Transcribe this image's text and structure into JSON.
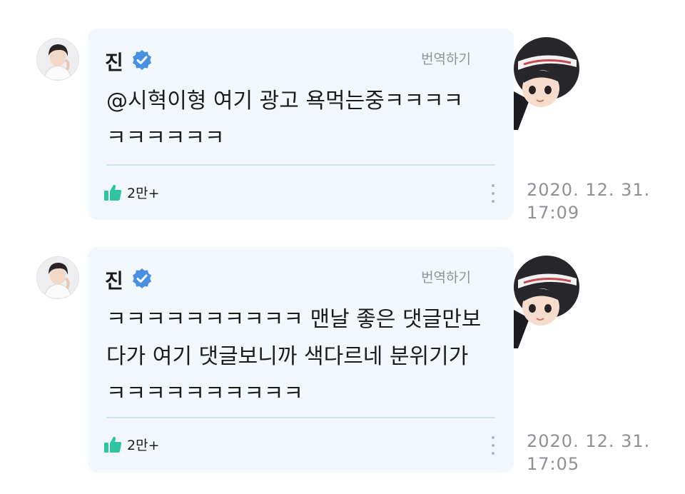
{
  "comments": [
    {
      "author": "진",
      "translate_label": "번역하기",
      "message": "@시혁이형 여기 광고 욕먹는중ㅋㅋㅋㅋ\nㅋㅋㅋㅋㅋㅋ",
      "likes": "2만+",
      "date": "2020. 12. 31.",
      "time": "17:09"
    },
    {
      "author": "진",
      "translate_label": "번역하기",
      "message": "ㅋㅋㅋㅋㅋㅋㅋㅋㅋㅋ 맨날 좋은 댓글만보\n다가 여기 댓글보니까 색다르네 분위기가\nㅋㅋㅋㅋㅋㅋㅋㅋㅋㅋ",
      "likes": "2만+",
      "date": "2020. 12. 31.",
      "time": "17:05"
    }
  ],
  "icons": {
    "verified": "verified-badge-icon",
    "like": "thumbs-up-icon",
    "more": "more-vertical-icon"
  },
  "colors": {
    "bubble_bg": "#f2f7fc",
    "verified_blue": "#4a90e2",
    "like_green": "#2ec4a0",
    "timestamp_gray": "#8d9096"
  }
}
